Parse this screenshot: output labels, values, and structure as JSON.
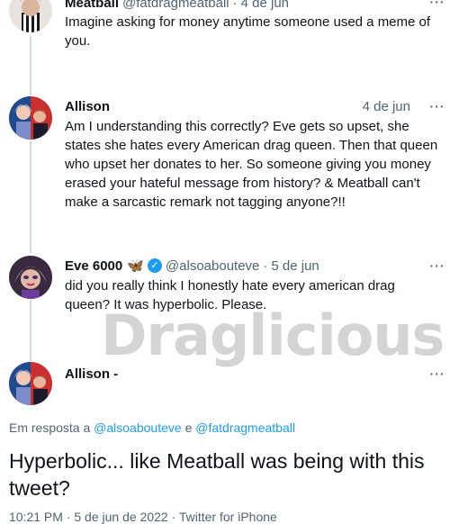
{
  "tweets": [
    {
      "name": "Meatball",
      "handle": "@fatdragmeatball",
      "time": "4 de jun",
      "text": "Imagine asking for money anytime someone used a meme of you."
    },
    {
      "name": "Allison",
      "time": "4 de jun",
      "text": "Am I understanding this correctly? Eve gets so upset, she states she hates every American drag queen. Then that queen who upset her donates to her. So someone giving you money erased your hateful message from history? & Meatball can't make a sarcastic remark not tagging anyone?!!"
    },
    {
      "name": "Eve 6000",
      "emoji": "🦋",
      "handle": "@alsoabouteve",
      "time": "5 de jun",
      "text": "did you really think I honestly hate every american drag queen? It was hyperbolic. Please."
    }
  ],
  "main_tweet": {
    "name": "Allison -",
    "replying_prefix": "Em resposta a",
    "replying_handle_1": "@alsoabouteve",
    "replying_joiner": "e",
    "replying_handle_2": "@fatdragmeatball",
    "text": "Hyperbolic... like Meatball was being with this tweet?",
    "meta": "10:21 PM · 5 de jun de 2022 · Twitter for iPhone"
  },
  "watermark": "Draglicious",
  "more_glyph": "···",
  "separator": "·",
  "verified_glyph": "✓",
  "colors": {
    "accent": "#1d9bf0",
    "text": "#0f1419",
    "muted": "#536471",
    "thread_line": "#cfd9de"
  }
}
